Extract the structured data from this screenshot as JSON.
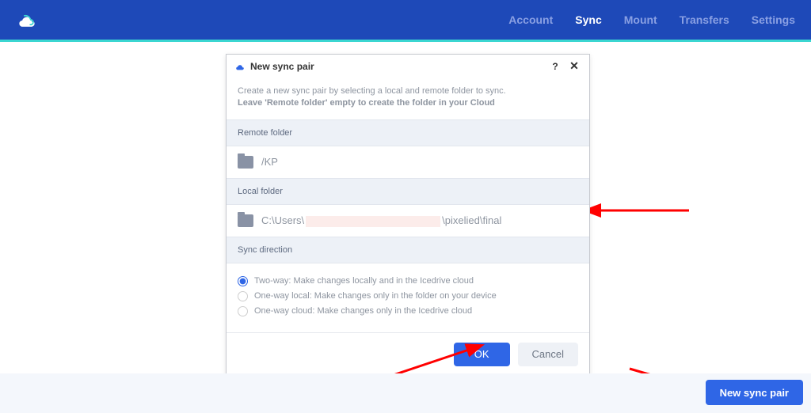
{
  "nav": {
    "items": [
      "Account",
      "Sync",
      "Mount",
      "Transfers",
      "Settings"
    ],
    "active_index": 1
  },
  "dialog": {
    "title": "New sync pair",
    "intro_line1": "Create a new sync pair by selecting a local and remote folder to sync.",
    "intro_line2_bold": "Leave 'Remote folder' empty to create the folder in your Cloud",
    "sections": {
      "remote_label": "Remote folder",
      "remote_path": "/KP",
      "local_label": "Local folder",
      "local_path_prefix": "C:\\Users\\",
      "local_path_suffix": "\\pixelied\\final",
      "direction_label": "Sync direction"
    },
    "directions": [
      {
        "label": "Two-way: Make changes locally and in the Icedrive cloud",
        "selected": true
      },
      {
        "label": "One-way local: Make changes only in the folder on your device",
        "selected": false
      },
      {
        "label": "One-way cloud: Make changes only in the Icedrive cloud",
        "selected": false
      }
    ],
    "ok": "OK",
    "cancel": "Cancel"
  },
  "footer_button": "New sync pair",
  "colors": {
    "accent": "#2f66e6",
    "topbar": "#1e49b8",
    "teal": "#3bd6d1",
    "arrow": "#ff0000"
  }
}
